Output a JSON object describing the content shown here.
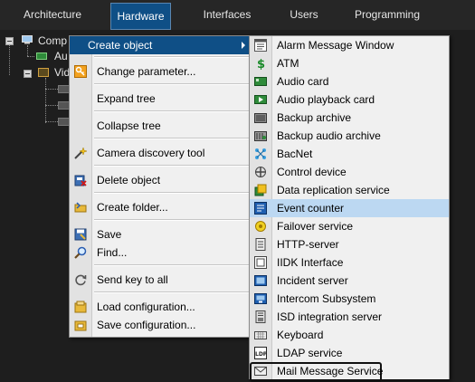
{
  "tabs": [
    "Architecture",
    "Hardware",
    "Interfaces",
    "Users",
    "Programming"
  ],
  "tree": {
    "root_label": "Comp",
    "child1_label": "Au",
    "child2_label": "Vid"
  },
  "context_menu": {
    "items": [
      {
        "label": "Create object",
        "icon": "none",
        "highlighted": true,
        "submenu": true
      },
      {
        "label": "Change parameter...",
        "icon": "key-icon"
      },
      {
        "label": "Expand tree",
        "icon": "none"
      },
      {
        "label": "Collapse tree",
        "icon": "none"
      },
      {
        "label": "Camera discovery tool",
        "icon": "wand-icon"
      },
      {
        "label": "Delete object",
        "icon": "delete-icon"
      },
      {
        "label": "Create folder...",
        "icon": "folder-arrow-icon"
      },
      {
        "label": "Save",
        "icon": "save-icon"
      },
      {
        "label": "Find...",
        "icon": "magnifier-icon"
      },
      {
        "label": "Send key to all",
        "icon": "refresh-icon"
      },
      {
        "label": "Load configuration...",
        "icon": "load-icon"
      },
      {
        "label": "Save configuration...",
        "icon": "save-config-icon"
      }
    ]
  },
  "submenu": {
    "items": [
      {
        "label": "Alarm Message Window",
        "icon": "alarm-window-icon"
      },
      {
        "label": "ATM",
        "icon": "dollar-icon"
      },
      {
        "label": "Audio card",
        "icon": "audio-card-icon"
      },
      {
        "label": "Audio playback card",
        "icon": "audio-playback-icon"
      },
      {
        "label": "Backup archive",
        "icon": "backup-archive-icon"
      },
      {
        "label": "Backup audio archive",
        "icon": "backup-audio-icon"
      },
      {
        "label": "BacNet",
        "icon": "bacnet-icon"
      },
      {
        "label": "Control device",
        "icon": "control-device-icon"
      },
      {
        "label": "Data replication service",
        "icon": "data-replication-icon"
      },
      {
        "label": "Event counter",
        "icon": "event-counter-icon",
        "highlighted": true
      },
      {
        "label": "Failover service",
        "icon": "failover-icon"
      },
      {
        "label": "HTTP-server",
        "icon": "http-server-icon"
      },
      {
        "label": "IIDK Interface",
        "icon": "iidk-icon"
      },
      {
        "label": "Incident server",
        "icon": "incident-server-icon"
      },
      {
        "label": "Intercom Subsystem",
        "icon": "intercom-icon"
      },
      {
        "label": "ISD integration server",
        "icon": "isd-icon"
      },
      {
        "label": "Keyboard",
        "icon": "keyboard-icon"
      },
      {
        "label": "LDAP service",
        "icon": "ldap-icon"
      },
      {
        "label": "Mail Message Service",
        "icon": "mail-icon"
      }
    ]
  },
  "colors": {
    "accent": "#0f4f86",
    "highlight_light": "#bcd8f2",
    "background": "#1e1e1e",
    "menu_bg": "#f0f0f0"
  }
}
